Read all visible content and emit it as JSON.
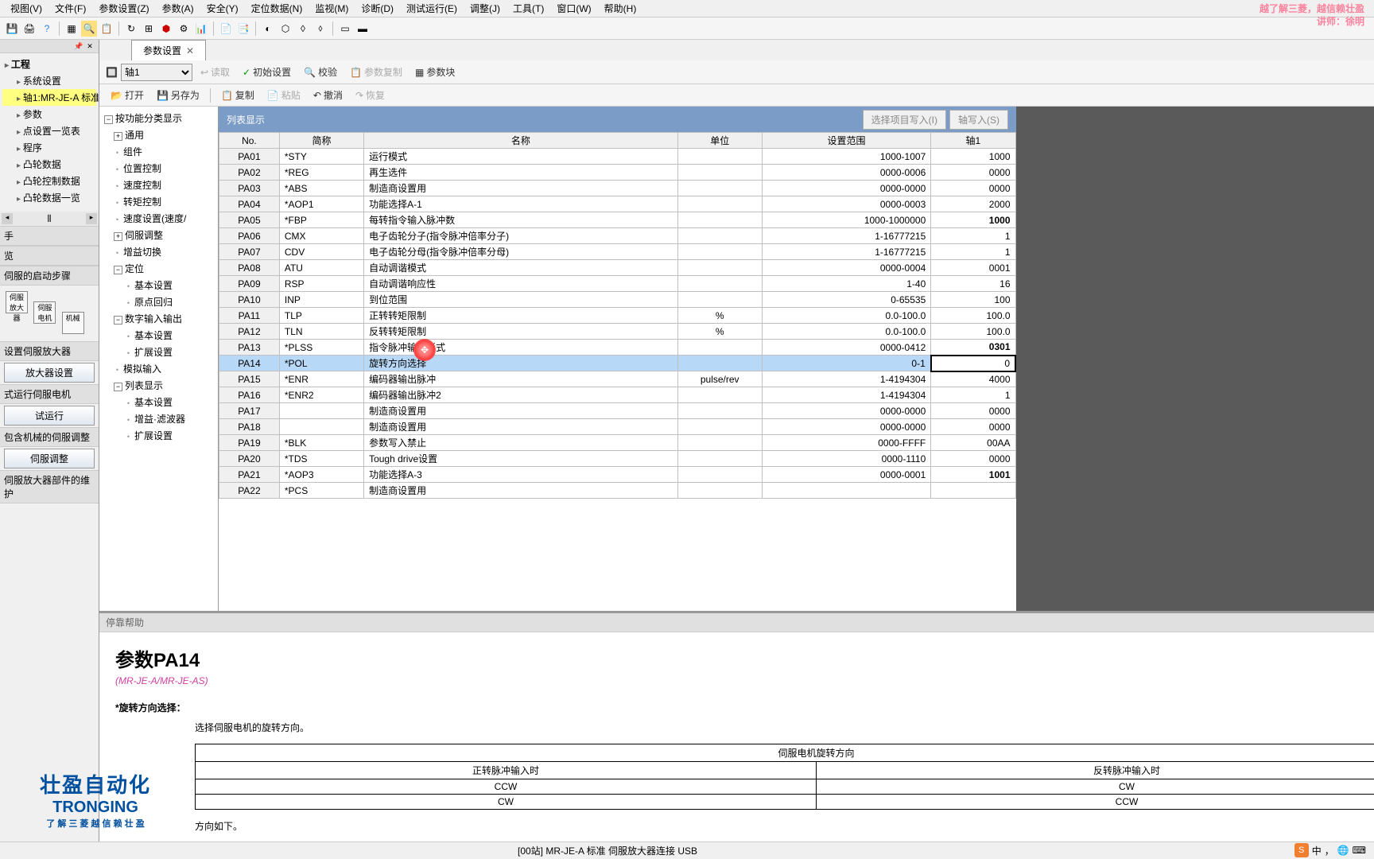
{
  "watermark": {
    "line1": "越了解三菱，越信赖壮盈",
    "line2": "讲师：徐明"
  },
  "menu": [
    "视图(V)",
    "文件(F)",
    "参数设置(Z)",
    "参数(A)",
    "安全(Y)",
    "定位数据(N)",
    "监视(M)",
    "诊断(D)",
    "测试运行(E)",
    "调整(J)",
    "工具(T)",
    "窗口(W)",
    "帮助(H)"
  ],
  "left": {
    "hdr1": "工程",
    "tree": [
      "系统设置",
      "轴1:MR-JE-A 标准",
      "参数",
      "点设置一览表",
      "程序",
      "凸轮数据",
      "凸轮控制数据",
      "凸轮数据一览"
    ],
    "hdr2": "手",
    "hdr3": "览",
    "sec1": "伺服的启动步骤",
    "box1": "伺服放大器",
    "box2": "伺服电机",
    "box3": "机械",
    "sec2": "设置伺服放大器",
    "btn2": "放大器设置",
    "sec3": "式运行伺服电机",
    "btn3": "试运行",
    "sec4": "包含机械的伺服调整",
    "btn4": "伺服调整",
    "sec5": "伺服放大器部件的维护"
  },
  "tab": {
    "title": "参数设置"
  },
  "ctb": {
    "axis": "轴1",
    "read": "读取",
    "init": "初始设置",
    "verify": "校验",
    "copy": "参数复制",
    "block": "参数块"
  },
  "ctb2": {
    "open": "打开",
    "saveas": "另存为",
    "copy": "复制",
    "paste": "粘贴",
    "undo": "撤消",
    "redo": "恢复"
  },
  "cat": {
    "root": "按功能分类显示",
    "items": [
      "通用",
      "组件",
      "位置控制",
      "速度控制",
      "转矩控制",
      "速度设置(速度/",
      "伺服调整",
      "增益切换",
      "定位",
      "基本设置",
      "原点回归",
      "数字输入输出",
      "基本设置",
      "扩展设置",
      "模拟输入",
      "列表显示",
      "基本设置",
      "增益·滤波器",
      "扩展设置"
    ]
  },
  "tabletop": {
    "title": "列表显示",
    "btn1": "选择项目写入(I)",
    "btn2": "轴写入(S)"
  },
  "cols": {
    "no": "No.",
    "abbr": "简称",
    "name": "名称",
    "unit": "单位",
    "range": "设置范围",
    "axis": "轴1"
  },
  "rows": [
    {
      "no": "PA01",
      "abbr": "*STY",
      "name": "运行模式",
      "unit": "",
      "range": "1000-1007",
      "val": "1000"
    },
    {
      "no": "PA02",
      "abbr": "*REG",
      "name": "再生选件",
      "unit": "",
      "range": "0000-0006",
      "val": "0000"
    },
    {
      "no": "PA03",
      "abbr": "*ABS",
      "name": "制造商设置用",
      "unit": "",
      "range": "0000-0000",
      "val": "0000"
    },
    {
      "no": "PA04",
      "abbr": "*AOP1",
      "name": "功能选择A-1",
      "unit": "",
      "range": "0000-0003",
      "val": "2000"
    },
    {
      "no": "PA05",
      "abbr": "*FBP",
      "name": "每转指令输入脉冲数",
      "unit": "",
      "range": "1000-1000000",
      "val": "1000",
      "bold": true
    },
    {
      "no": "PA06",
      "abbr": "CMX",
      "name": "电子齿轮分子(指令脉冲倍率分子)",
      "unit": "",
      "range": "1-16777215",
      "val": "1"
    },
    {
      "no": "PA07",
      "abbr": "CDV",
      "name": "电子齿轮分母(指令脉冲倍率分母)",
      "unit": "",
      "range": "1-16777215",
      "val": "1"
    },
    {
      "no": "PA08",
      "abbr": "ATU",
      "name": "自动调谐模式",
      "unit": "",
      "range": "0000-0004",
      "val": "0001"
    },
    {
      "no": "PA09",
      "abbr": "RSP",
      "name": "自动调谐响应性",
      "unit": "",
      "range": "1-40",
      "val": "16"
    },
    {
      "no": "PA10",
      "abbr": "INP",
      "name": "到位范围",
      "unit": "",
      "range": "0-65535",
      "val": "100"
    },
    {
      "no": "PA11",
      "abbr": "TLP",
      "name": "正转转矩限制",
      "unit": "%",
      "range": "0.0-100.0",
      "val": "100.0"
    },
    {
      "no": "PA12",
      "abbr": "TLN",
      "name": "反转转矩限制",
      "unit": "%",
      "range": "0.0-100.0",
      "val": "100.0"
    },
    {
      "no": "PA13",
      "abbr": "*PLSS",
      "name": "指令脉冲输入形式",
      "unit": "",
      "range": "0000-0412",
      "val": "0301",
      "bold": true
    },
    {
      "no": "PA14",
      "abbr": "*POL",
      "name": "旋转方向选择",
      "unit": "",
      "range": "0-1",
      "val": "0",
      "sel": true
    },
    {
      "no": "PA15",
      "abbr": "*ENR",
      "name": "编码器输出脉冲",
      "unit": "pulse/rev",
      "range": "1-4194304",
      "val": "4000"
    },
    {
      "no": "PA16",
      "abbr": "*ENR2",
      "name": "编码器输出脉冲2",
      "unit": "",
      "range": "1-4194304",
      "val": "1"
    },
    {
      "no": "PA17",
      "abbr": "",
      "name": "制造商设置用",
      "unit": "",
      "range": "0000-0000",
      "val": "0000"
    },
    {
      "no": "PA18",
      "abbr": "",
      "name": "制造商设置用",
      "unit": "",
      "range": "0000-0000",
      "val": "0000"
    },
    {
      "no": "PA19",
      "abbr": "*BLK",
      "name": "参数写入禁止",
      "unit": "",
      "range": "0000-FFFF",
      "val": "00AA"
    },
    {
      "no": "PA20",
      "abbr": "*TDS",
      "name": "Tough drive设置",
      "unit": "",
      "range": "0000-1110",
      "val": "0000"
    },
    {
      "no": "PA21",
      "abbr": "*AOP3",
      "name": "功能选择A-3",
      "unit": "",
      "range": "0000-0001",
      "val": "1001",
      "bold": true
    },
    {
      "no": "PA22",
      "abbr": "*PCS",
      "name": "制造商设置用",
      "unit": "",
      "range": "",
      "val": ""
    }
  ],
  "help": {
    "hdr": "停靠帮助",
    "title": "参数PA14",
    "sub": "(MR-JE-A/MR-JE-AS)",
    "sec_title": "*旋转方向选择：",
    "desc": "选择伺服电机的旋转方向。",
    "th0": "伺服电机旋转方向",
    "th1": "正转脉冲输入时",
    "th2": "反转脉冲输入时",
    "r1c1": "CCW",
    "r1c2": "CW",
    "r2c1": "CW",
    "r2c2": "CCW",
    "foot": "方向如下。"
  },
  "status": {
    "center": "[00站] MR-JE-A 标准 伺服放大器连接 USB"
  },
  "logo": {
    "cn": "壮盈自动化",
    "en": "TRONGING",
    "sm": "了 解 三 菱   越 信 赖 壮 盈"
  },
  "ime": "中"
}
